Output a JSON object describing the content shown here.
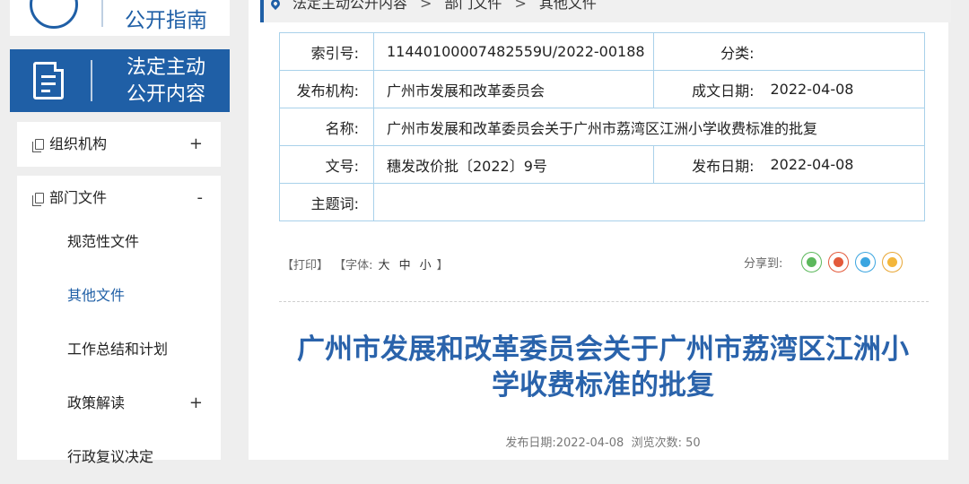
{
  "sidebar": {
    "guide_title": "公开指南",
    "active_title_line1": "法定主动",
    "active_title_line2": "公开内容",
    "groups": [
      {
        "label": "组织机构",
        "toggle": "+"
      },
      {
        "label": "部门文件",
        "toggle": "-"
      }
    ],
    "sub_items": [
      {
        "label": "规范性文件",
        "toggle": ""
      },
      {
        "label": "其他文件",
        "toggle": ""
      },
      {
        "label": "工作总结和计划",
        "toggle": ""
      },
      {
        "label": "政策解读",
        "toggle": "+"
      },
      {
        "label": "行政复议决定",
        "toggle": ""
      }
    ]
  },
  "breadcrumb": {
    "items": [
      "法定主动公开内容",
      "部门文件",
      "其他文件"
    ],
    "separator": ">"
  },
  "meta": {
    "index_label": "索引号:",
    "index_value": "11440100007482559U/2022-00188",
    "category_label": "分类:",
    "category_value": "",
    "publisher_label": "发布机构:",
    "publisher_value": "广州市发展和改革委员会",
    "written_date_label": "成文日期:",
    "written_date_value": "2022-04-08",
    "name_label": "名称:",
    "name_value": "广州市发展和改革委员会关于广州市荔湾区江洲小学收费标准的批复",
    "doc_no_label": "文号:",
    "doc_no_value": "穗发改价批〔2022〕9号",
    "publish_date_label": "发布日期:",
    "publish_date_value": "2022-04-08",
    "keywords_label": "主题词:",
    "keywords_value": ""
  },
  "tools": {
    "print": "【打印】",
    "font_prefix": "【字体:",
    "font_large": "大",
    "font_medium": "中",
    "font_small": "小",
    "font_suffix": "】",
    "share_label": "分享到:"
  },
  "article": {
    "title_line1": "广州市发展和改革委员会关于广州市荔湾区江洲小",
    "title_line2": "学收费标准的批复",
    "date_label": "发布日期:",
    "date_value": "2022-04-08",
    "views_label": "浏览次数:",
    "views_value": "50"
  },
  "colors": {
    "brand": "#1f5fa6",
    "title": "#2a63ab",
    "table_border": "#a9d1ea"
  }
}
